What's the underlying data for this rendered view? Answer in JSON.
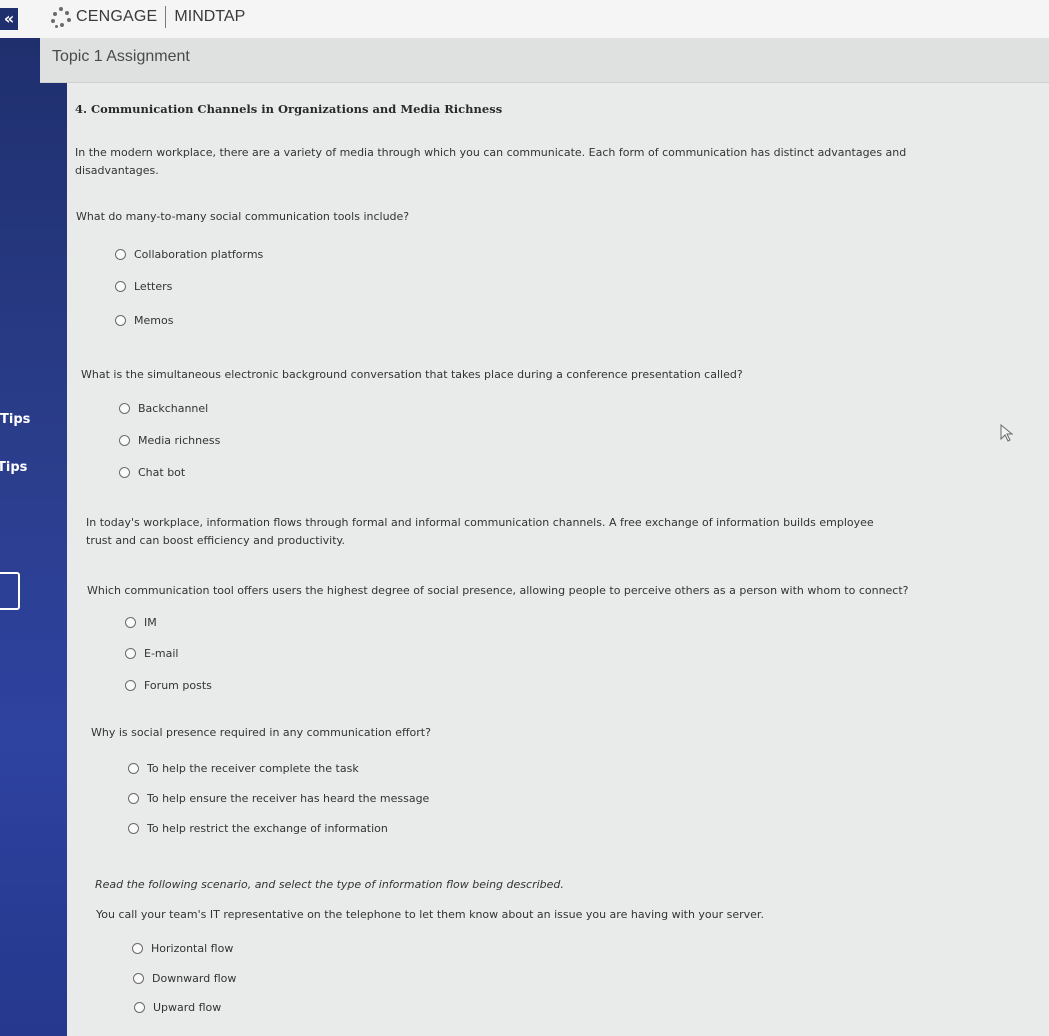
{
  "sidebar": {
    "collapse_label": "«",
    "tips": [
      "Tips",
      "Tips"
    ]
  },
  "header": {
    "brand": "CENGAGE",
    "product": "MINDTAP",
    "assignment_title": "Topic 1 Assignment"
  },
  "content": {
    "question_title": "4. Communication Channels in Organizations and Media Richness",
    "intro": "In the modern workplace, there are a variety of media through which you can communicate. Each form of communication has distinct advantages and disadvantages.",
    "questions": [
      {
        "text": "What do many-to-many social communication tools include?",
        "options": [
          "Collaboration platforms",
          "Letters",
          "Memos"
        ]
      },
      {
        "text": "What is the simultaneous electronic background conversation that takes place during a conference presentation called?",
        "options": [
          "Backchannel",
          "Media richness",
          "Chat bot"
        ]
      },
      {
        "text": "Which communication tool offers users the highest degree of social presence, allowing people to perceive others as a person with whom to connect?",
        "options": [
          "IM",
          "E-mail",
          "Forum posts"
        ]
      },
      {
        "text": "Why is social presence required in any communication effort?",
        "options": [
          "To help the receiver complete the task",
          "To help ensure the receiver has heard the message",
          "To help restrict the exchange of information"
        ]
      },
      {
        "text": "You call your team's IT representative on the telephone to let them know about an issue you are having with your server.",
        "options": [
          "Horizontal flow",
          "Downward flow",
          "Upward flow"
        ]
      }
    ],
    "info_paragraph": "In today's workplace, information flows through formal and informal communication channels. A free exchange of information builds employee trust and can boost efficiency and productivity.",
    "scenario_instruction": "Read the following scenario, and select the type of information flow being described."
  },
  "colors": {
    "sidebar": "#2a3d8a",
    "background": "#e9ebea"
  }
}
